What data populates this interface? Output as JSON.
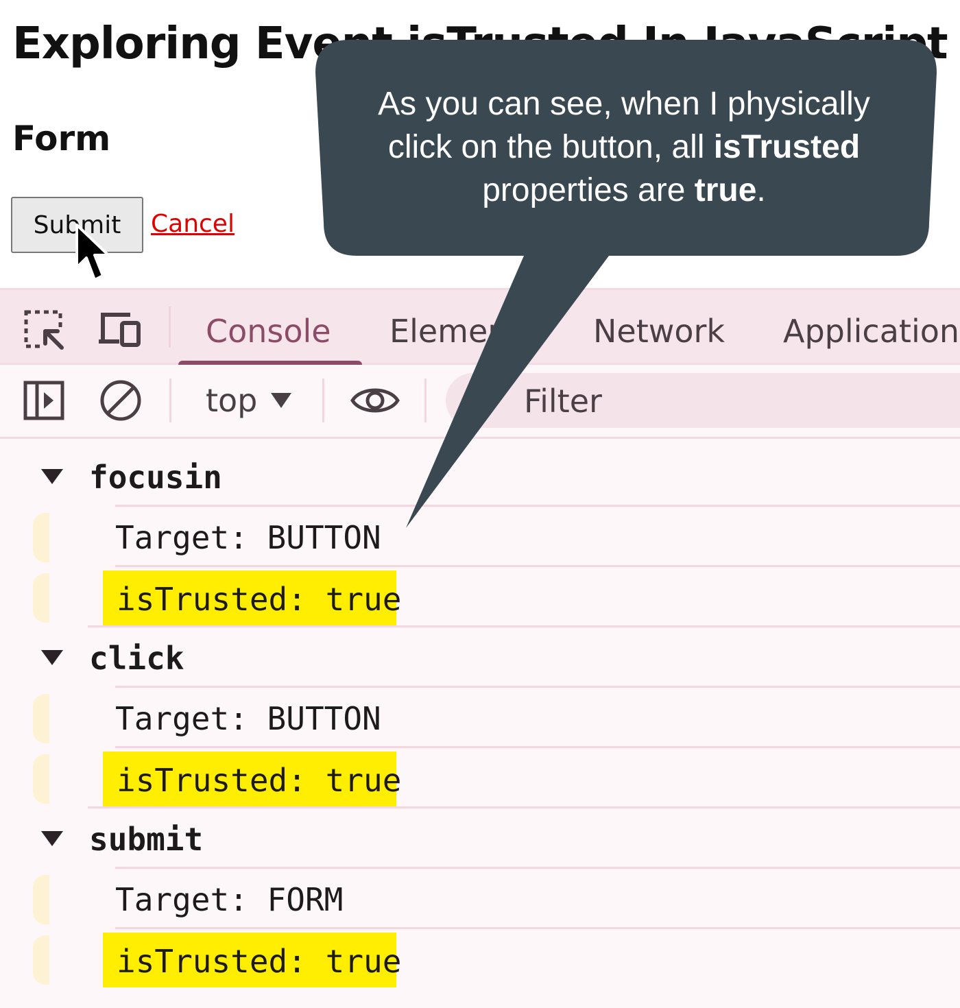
{
  "page": {
    "title": "Exploring Event isTrusted In JavaScript",
    "form_heading": "Form",
    "submit_label": "Submit",
    "cancel_label": "Cancel"
  },
  "devtools": {
    "tabs": [
      {
        "label": "Console",
        "active": true
      },
      {
        "label": "Elements",
        "active": false
      },
      {
        "label": "Network",
        "active": false
      },
      {
        "label": "Application",
        "active": false
      }
    ],
    "toolbar": {
      "context": "top",
      "filter_placeholder": "Filter"
    },
    "groups": [
      {
        "label": "focusin",
        "target": "Target: BUTTON",
        "trusted": "isTrusted: true"
      },
      {
        "label": "click",
        "target": "Target: BUTTON",
        "trusted": "isTrusted: true"
      },
      {
        "label": "submit",
        "target": "Target: FORM",
        "trusted": "isTrusted: true"
      }
    ],
    "colors": {
      "accent": "#8c4c68",
      "highlight": "#ffee00",
      "tabbar_bg": "#f6e5ea"
    }
  },
  "callout": {
    "text_1": "As you can see, when I physically click on the button, all ",
    "bold_1": "isTrusted",
    "text_2": " properties are ",
    "bold_2": "true",
    "text_3": ".",
    "bg_color": "#3a4852"
  }
}
